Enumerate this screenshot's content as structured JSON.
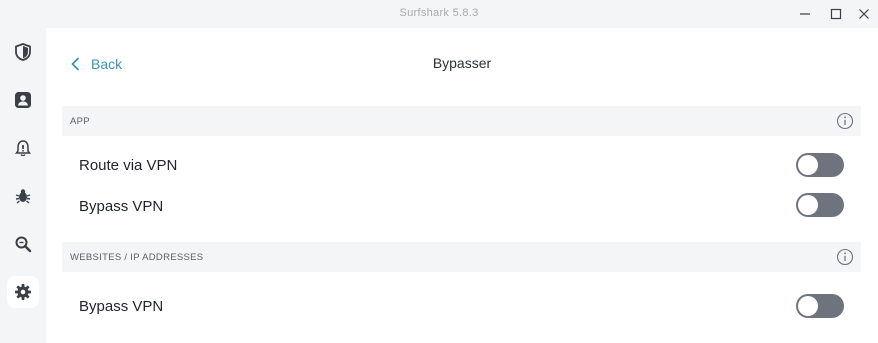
{
  "window": {
    "title": "Surfshark 5.8.3"
  },
  "sidebar": {
    "items": [
      {
        "icon": "shield-icon",
        "active": false
      },
      {
        "icon": "user-icon",
        "active": false
      },
      {
        "icon": "alert-icon",
        "active": false
      },
      {
        "icon": "bug-icon",
        "active": false
      },
      {
        "icon": "search-icon",
        "active": false
      },
      {
        "icon": "gear-icon",
        "active": true
      }
    ]
  },
  "header": {
    "back_label": "Back",
    "title": "Bypasser"
  },
  "sections": {
    "app": {
      "label": "APP",
      "rows": [
        {
          "label": "Route via VPN",
          "enabled": false
        },
        {
          "label": "Bypass VPN",
          "enabled": false
        }
      ]
    },
    "websites": {
      "label": "WEBSITES / IP ADDRESSES",
      "rows": [
        {
          "label": "Bypass VPN",
          "enabled": false
        }
      ]
    }
  },
  "colors": {
    "accent": "#3a95b5",
    "toggle_off": "#6e737e",
    "section_bg": "#f4f5f7"
  }
}
